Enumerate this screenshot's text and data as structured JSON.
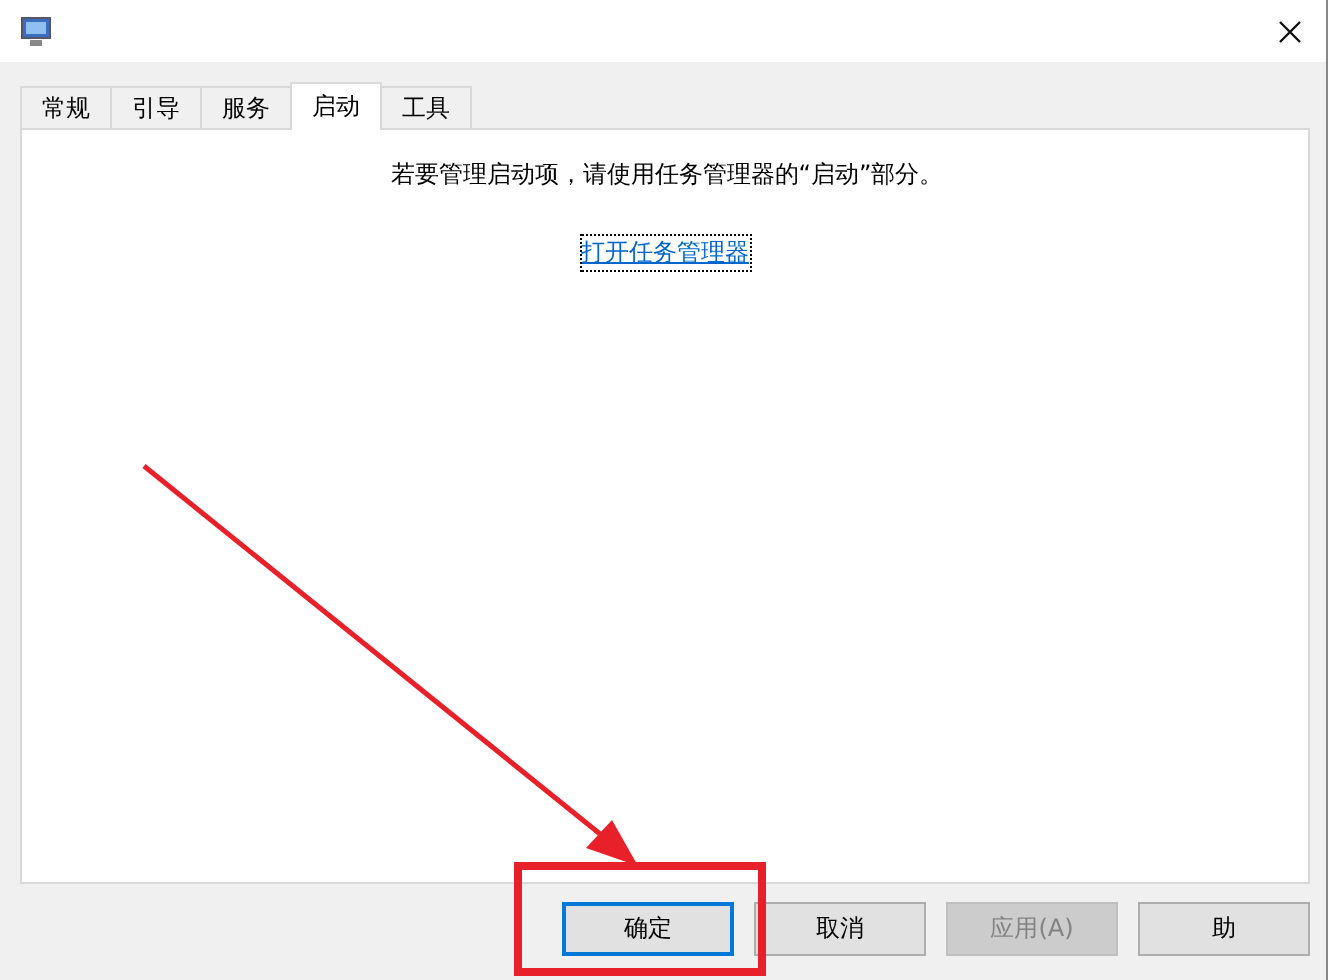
{
  "tabs": [
    {
      "label": "常规",
      "selected": false
    },
    {
      "label": "引导",
      "selected": false
    },
    {
      "label": "服务",
      "selected": false
    },
    {
      "label": "启动",
      "selected": true
    },
    {
      "label": "工具",
      "selected": false
    }
  ],
  "message": "若要管理启动项，请使用任务管理器的“启动”部分。",
  "link": "打开任务管理器",
  "buttons": [
    {
      "label": "确定",
      "default": true,
      "disabled": false
    },
    {
      "label": "取消",
      "default": false,
      "disabled": false
    },
    {
      "label": "应用(A)",
      "default": false,
      "disabled": true
    },
    {
      "label": "助",
      "default": false,
      "disabled": false
    }
  ]
}
